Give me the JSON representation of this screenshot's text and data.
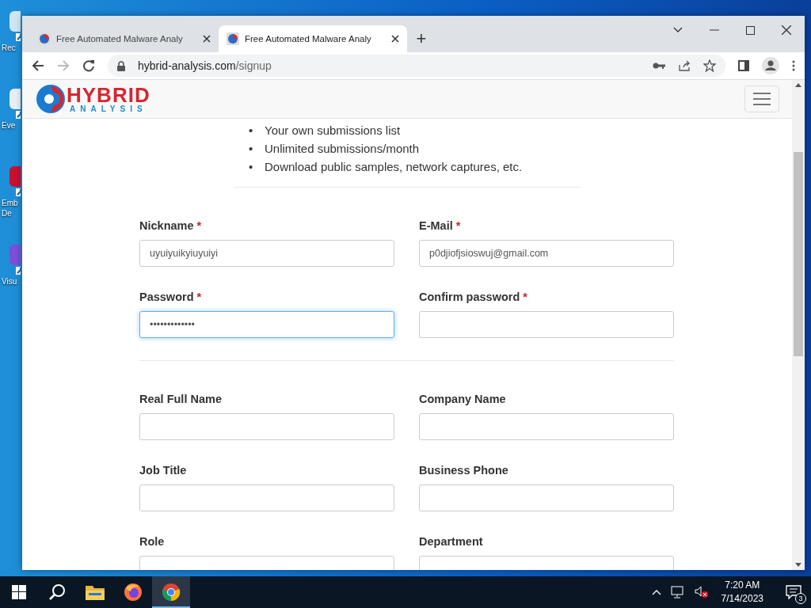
{
  "desktop_icons": [
    {
      "lines": [
        "Rec"
      ]
    },
    {
      "lines": [
        "Eve"
      ]
    },
    {
      "lines": [
        "Emb",
        "De"
      ]
    },
    {
      "lines": [
        "Visu"
      ]
    }
  ],
  "browser": {
    "tabs": [
      {
        "title": "Free Automated Malware Analy",
        "selected": false
      },
      {
        "title": "Free Automated Malware Analy",
        "selected": true
      }
    ],
    "new_tab": "+",
    "url": {
      "host": "hybrid-analysis.com",
      "path": "/signup"
    }
  },
  "page": {
    "logo": {
      "word": "HYBRID",
      "subword": "ANALYSIS"
    },
    "benefits": [
      {
        "bullet": "•",
        "text": "Your own submissions list"
      },
      {
        "bullet": "•",
        "text": "Unlimited submissions/month"
      },
      {
        "bullet": "•",
        "text": "Download public samples, network captures, etc."
      }
    ],
    "sections": [
      {
        "fields": [
          {
            "label": "Nickname",
            "required_mark": "*",
            "value": "uyuiyuikyiuyuiyi",
            "focused": false
          },
          {
            "label": "E-Mail",
            "required_mark": "*",
            "value": "p0djiofjsioswuj@gmail.com",
            "focused": false
          },
          {
            "label": "Password",
            "required_mark": "*",
            "value": "•••••••••••••",
            "focused": true
          },
          {
            "label": "Confirm password",
            "required_mark": "*",
            "focused": false
          }
        ]
      },
      {
        "fields": [
          {
            "label": "Real Full Name",
            "focused": false
          },
          {
            "label": "Company Name",
            "focused": false
          },
          {
            "label": "Job Title",
            "focused": false
          },
          {
            "label": "Business Phone",
            "focused": false
          },
          {
            "label": "Role",
            "focused": false
          },
          {
            "label": "Department",
            "focused": false
          }
        ]
      }
    ]
  },
  "taskbar": {
    "apps": [
      {
        "kind": "start",
        "selected": false
      },
      {
        "kind": "search",
        "selected": false
      },
      {
        "kind": "folder",
        "selected": false
      },
      {
        "kind": "firefox",
        "selected": false
      },
      {
        "kind": "chrome",
        "selected": true
      }
    ],
    "time": "7:20 AM",
    "date": "7/14/2023",
    "notifications": "3"
  }
}
